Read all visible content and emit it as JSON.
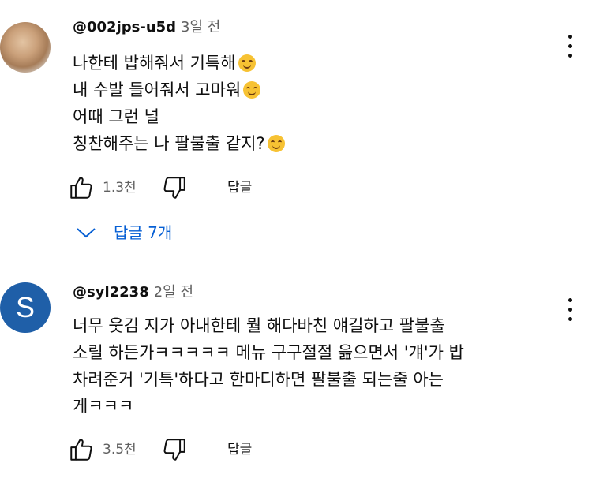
{
  "comments": [
    {
      "author": "@002jps-u5d",
      "time": "3일 전",
      "lines": [
        "나한테 밥해줘서 기특해",
        "내 수발 들어줘서 고마워",
        "어때 그런 널",
        "칭찬해주는 나 팔불출 같지?"
      ],
      "line_emoji": [
        true,
        true,
        false,
        true
      ],
      "likes": "1.3천",
      "reply_label": "답글",
      "replies_label": "답글 7개"
    },
    {
      "author": "@syl2238",
      "avatar_letter": "S",
      "time": "2일 전",
      "lines": [
        "너무 웃김 지가 아내한테 뭘 해다바친 얘길하고 팔불출",
        "소릴 하든가ㅋㅋㅋㅋㅋ 메뉴 구구절절 읊으면서 '걔'가 밥",
        "차려준거 '기특'하다고 한마디하면 팔불출 되는줄 아는",
        "게ㅋㅋㅋ"
      ],
      "likes": "3.5천",
      "reply_label": "답글"
    }
  ],
  "colors": {
    "link": "#065fd4",
    "secondary": "#606060",
    "avatar_s": "#1f5fa8"
  },
  "icons": [
    "thumb-up-icon",
    "thumb-down-icon",
    "more-vert-icon",
    "chevron-down-icon",
    "smile-emoji-icon"
  ]
}
